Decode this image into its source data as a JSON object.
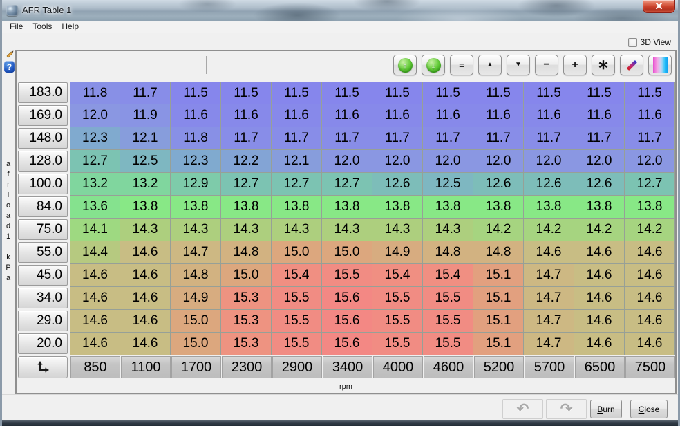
{
  "window": {
    "title": "AFR Table 1"
  },
  "menu": {
    "items": [
      {
        "label": "File",
        "mnemonic": "F"
      },
      {
        "label": "Tools",
        "mnemonic": "T"
      },
      {
        "label": "Help",
        "mnemonic": "H"
      }
    ]
  },
  "view_3d": {
    "label": "3D View",
    "mnemonic": "D",
    "checked": false
  },
  "toolbar": {
    "buttons": [
      {
        "name": "scale-up-button",
        "icon": "circle-arrow",
        "glyph": "↑"
      },
      {
        "name": "scale-down-button",
        "icon": "circle-arrow",
        "glyph": "↓"
      },
      {
        "name": "set-equal-button",
        "icon": "glyph",
        "glyph": "=",
        "cls": "g-eq"
      },
      {
        "name": "increment-button",
        "icon": "glyph",
        "glyph": "▲",
        "cls": "g-tri"
      },
      {
        "name": "decrement-button",
        "icon": "glyph",
        "glyph": "▼",
        "cls": "g-tri"
      },
      {
        "name": "subtract-button",
        "icon": "glyph",
        "glyph": "−",
        "cls": "g-pm"
      },
      {
        "name": "add-button",
        "icon": "glyph",
        "glyph": "+",
        "cls": "g-pm"
      },
      {
        "name": "multiply-button",
        "icon": "glyph",
        "glyph": "∗",
        "cls": "g-ast"
      },
      {
        "name": "edit-pencil-button",
        "icon": "pencil"
      },
      {
        "name": "color-scale-button",
        "icon": "gradient"
      }
    ]
  },
  "table": {
    "y_axis_name": "afrload1",
    "y_axis_unit": "kPa",
    "x_axis_label": "rpm",
    "loads": [
      183.0,
      169.0,
      148.0,
      128.0,
      100.0,
      84.0,
      75.0,
      55.0,
      45.0,
      34.0,
      29.0,
      20.0
    ],
    "rpms": [
      850,
      1100,
      1700,
      2300,
      2900,
      3400,
      4000,
      4600,
      5200,
      5700,
      6500,
      7500
    ],
    "values": [
      [
        11.8,
        11.7,
        11.5,
        11.5,
        11.5,
        11.5,
        11.5,
        11.5,
        11.5,
        11.5,
        11.5,
        11.5
      ],
      [
        12.0,
        11.9,
        11.6,
        11.6,
        11.6,
        11.6,
        11.6,
        11.6,
        11.6,
        11.6,
        11.6,
        11.6
      ],
      [
        12.3,
        12.1,
        11.8,
        11.7,
        11.7,
        11.7,
        11.7,
        11.7,
        11.7,
        11.7,
        11.7,
        11.7
      ],
      [
        12.7,
        12.5,
        12.3,
        12.2,
        12.1,
        12.0,
        12.0,
        12.0,
        12.0,
        12.0,
        12.0,
        12.0
      ],
      [
        13.2,
        13.2,
        12.9,
        12.7,
        12.7,
        12.7,
        12.6,
        12.5,
        12.6,
        12.6,
        12.6,
        12.7
      ],
      [
        13.6,
        13.8,
        13.8,
        13.8,
        13.8,
        13.8,
        13.8,
        13.8,
        13.8,
        13.8,
        13.8,
        13.8
      ],
      [
        14.1,
        14.3,
        14.3,
        14.3,
        14.3,
        14.3,
        14.3,
        14.3,
        14.2,
        14.2,
        14.2,
        14.2
      ],
      [
        14.4,
        14.6,
        14.7,
        14.8,
        15.0,
        15.0,
        14.9,
        14.8,
        14.8,
        14.6,
        14.6,
        14.6
      ],
      [
        14.6,
        14.6,
        14.8,
        15.0,
        15.4,
        15.5,
        15.4,
        15.4,
        15.1,
        14.7,
        14.6,
        14.6
      ],
      [
        14.6,
        14.6,
        14.9,
        15.3,
        15.5,
        15.6,
        15.5,
        15.5,
        15.1,
        14.7,
        14.6,
        14.6
      ],
      [
        14.6,
        14.6,
        15.0,
        15.3,
        15.5,
        15.6,
        15.5,
        15.5,
        15.1,
        14.7,
        14.6,
        14.6
      ],
      [
        14.6,
        14.6,
        15.0,
        15.3,
        15.5,
        15.6,
        15.5,
        15.5,
        15.1,
        14.7,
        14.6,
        14.6
      ]
    ]
  },
  "colormap": {
    "stops": [
      {
        "v": 11.5,
        "c": "#8686ec"
      },
      {
        "v": 12.0,
        "c": "#8a97e2"
      },
      {
        "v": 12.3,
        "c": "#80aacf"
      },
      {
        "v": 12.7,
        "c": "#7cc3b2"
      },
      {
        "v": 13.2,
        "c": "#80d69e"
      },
      {
        "v": 13.8,
        "c": "#88e886"
      },
      {
        "v": 14.3,
        "c": "#adcf7e"
      },
      {
        "v": 14.6,
        "c": "#c8bd84"
      },
      {
        "v": 15.0,
        "c": "#dca77e"
      },
      {
        "v": 15.3,
        "c": "#ee9381"
      },
      {
        "v": 15.6,
        "c": "#f38884"
      }
    ]
  },
  "footer": {
    "undo_icon": "↶",
    "redo_icon": "↷",
    "burn": {
      "label": "Burn",
      "mnemonic": "B"
    },
    "close": {
      "label": "Close",
      "mnemonic": "C"
    }
  }
}
